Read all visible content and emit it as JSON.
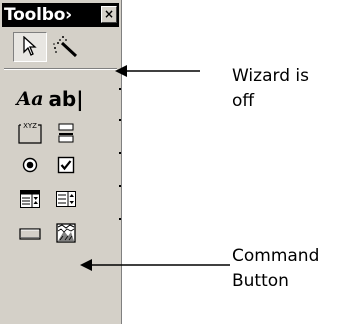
{
  "toolbox": {
    "title": "Toolbo›",
    "close_glyph": "×",
    "tools": [
      {
        "name": "select-objects-tool",
        "pressed": true
      },
      {
        "name": "control-wizards-tool",
        "pressed": false
      },
      {
        "name": "label-tool",
        "text": "Aa"
      },
      {
        "name": "text-box-tool",
        "text": "ab|"
      },
      {
        "name": "option-group-tool",
        "text": "XYZ"
      },
      {
        "name": "toggle-button-tool"
      },
      {
        "name": "option-button-tool"
      },
      {
        "name": "check-box-tool"
      },
      {
        "name": "combo-box-tool"
      },
      {
        "name": "list-box-tool"
      },
      {
        "name": "command-button-tool"
      },
      {
        "name": "image-tool"
      }
    ]
  },
  "annotations": {
    "wizard_line1": "Wizard is",
    "wizard_line2": "off",
    "command_line1": "Command",
    "command_line2": "Button"
  }
}
